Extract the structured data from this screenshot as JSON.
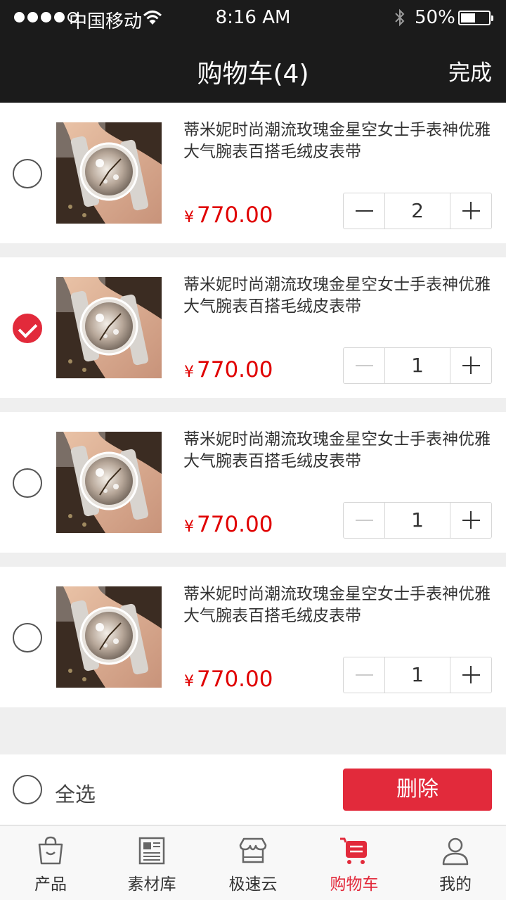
{
  "status_bar": {
    "carrier": "中国移动",
    "time": "8:16 AM",
    "battery": "50%"
  },
  "nav": {
    "title": "购物车(4)",
    "done": "完成"
  },
  "cart": {
    "items": [
      {
        "title": "蒂米妮时尚潮流玫瑰金星空女士手表神优雅大气腕表百搭毛绒皮表带",
        "currency": "¥",
        "price": "770.00",
        "quantity": "2",
        "selected": false
      },
      {
        "title": "蒂米妮时尚潮流玫瑰金星空女士手表神优雅大气腕表百搭毛绒皮表带",
        "currency": "¥",
        "price": "770.00",
        "quantity": "1",
        "selected": true
      },
      {
        "title": "蒂米妮时尚潮流玫瑰金星空女士手表神优雅大气腕表百搭毛绒皮表带",
        "currency": "¥",
        "price": "770.00",
        "quantity": "1",
        "selected": false
      },
      {
        "title": "蒂米妮时尚潮流玫瑰金星空女士手表神优雅大气腕表百搭毛绒皮表带",
        "currency": "¥",
        "price": "770.00",
        "quantity": "1",
        "selected": false
      }
    ]
  },
  "action_bar": {
    "select_all": "全选",
    "delete": "删除"
  },
  "tabbar": {
    "items": [
      {
        "label": "产品",
        "icon": "bag-icon",
        "active": false
      },
      {
        "label": "素材库",
        "icon": "newspaper-icon",
        "active": false
      },
      {
        "label": "极速云",
        "icon": "store-icon",
        "active": false
      },
      {
        "label": "购物车",
        "icon": "cart-icon",
        "active": true
      },
      {
        "label": "我的",
        "icon": "user-icon",
        "active": false
      }
    ]
  },
  "colors": {
    "accent": "#e22a3b",
    "price": "#e00000",
    "nav_bg": "#1b1b1b"
  }
}
